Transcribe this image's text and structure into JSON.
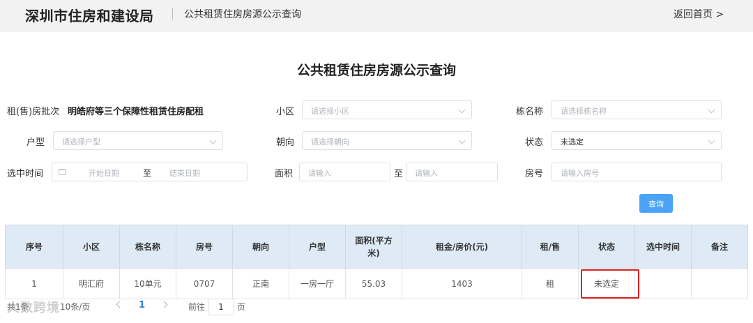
{
  "header": {
    "brand": "深圳市住房和建设局",
    "subtitle": "公共租赁住房房源公示查询",
    "back_link": "返回首页 >"
  },
  "page_title": "公共租赁住房房源公示查询",
  "filters": {
    "batch": {
      "label": "租(售)房批次",
      "value": "明皓府等三个保障性租赁住房配租"
    },
    "community": {
      "label": "小区",
      "placeholder": "请选择小区"
    },
    "building": {
      "label": "栋名称",
      "placeholder": "请选择栋名称"
    },
    "unit_type": {
      "label": "户型",
      "placeholder": "请选择户型"
    },
    "orientation": {
      "label": "朝向",
      "placeholder": "请选择朝向"
    },
    "status": {
      "label": "状态",
      "value": "未选定"
    },
    "select_time": {
      "label": "选中时间",
      "start_placeholder": "开始日期",
      "separator": "至",
      "end_placeholder": "结束日期"
    },
    "area": {
      "label": "面积",
      "min_placeholder": "请输入",
      "separator": "至",
      "max_placeholder": "请输入"
    },
    "room_no": {
      "label": "房号",
      "placeholder": "请输入房号"
    },
    "query_label": "查询"
  },
  "table": {
    "columns": [
      "序号",
      "小区",
      "栋名称",
      "房号",
      "朝向",
      "户型",
      "面积(平方米)",
      "租金/房价(元)",
      "租/售",
      "状态",
      "选中时间",
      "备注"
    ],
    "rows": [
      [
        "1",
        "明汇府",
        "10单元",
        "0707",
        "正南",
        "一房一厅",
        "55.03",
        "1403",
        "租",
        "未选定",
        "",
        ""
      ]
    ]
  },
  "pagination": {
    "total": "共1条",
    "size": "10条/页",
    "current_page": "1",
    "goto_label": "前往",
    "goto_value": "1",
    "page_suffix": "页"
  },
  "watermark": "大数跨境",
  "colors": {
    "accent": "#4aa3f7",
    "table_header_bg": "#deebf7",
    "highlight": "#e02020",
    "topbar_bg": "#f2f2f2"
  }
}
